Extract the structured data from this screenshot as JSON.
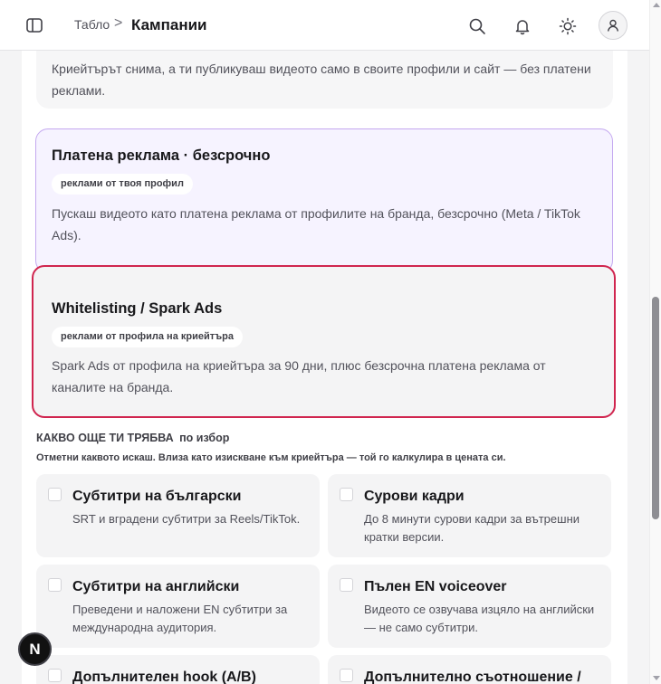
{
  "header": {
    "breadcrumb_parent": "Табло",
    "breadcrumb_separator": ">",
    "breadcrumb_current": "Кампании",
    "icons": [
      "sidebar-toggle-icon",
      "search-icon",
      "bell-icon",
      "sun-icon",
      "user-icon"
    ]
  },
  "options": {
    "organic": {
      "description": "Криейтърът снима, а ти публикуваш видеото само в своите профили и сайт — без платени реклами."
    },
    "paid": {
      "title": "Платена реклама · безсрочно",
      "pill": "реклами от твоя профил",
      "description": "Пускаш видеото като платена реклама от профилите на бранда, безсрочно (Meta / TikTok Ads)."
    },
    "spark": {
      "title": "Whitelisting / Spark Ads",
      "pill": "реклами от профила на криейтъра",
      "description": "Spark Ads от профила на криейтъра за 90 дни, плюс безсрочна платена реклама от каналите на бранда."
    }
  },
  "extras": {
    "heading": "КАКВО ОЩЕ ТИ ТРЯБВА",
    "heading_tag": "по избор",
    "hint": "Отметни каквото искаш. Влиза като изискване към криейтъра — той го калкулира в цената си.",
    "items": [
      {
        "title": "Субтитри на български",
        "description": "SRT и вградени субтитри за Reels/TikTok.",
        "checked": false
      },
      {
        "title": "Сурови кадри",
        "description": "До 8 минути сурови кадри за вътрешни кратки версии.",
        "checked": false
      },
      {
        "title": "Субтитри на английски",
        "description": "Преведени и наложени EN субтитри за международна аудитория.",
        "checked": false
      },
      {
        "title": "Пълен EN voiceover",
        "description": "Видеото се озвучава изцяло на английски — не само субтитри.",
        "checked": false
      },
      {
        "title": "Допълнителен hook (A/B)",
        "description": "",
        "checked": false
      },
      {
        "title": "Допълнително съотношение /",
        "description": "",
        "checked": false
      }
    ]
  },
  "colors": {
    "accent_purple_border": "#c4a8f0",
    "accent_purple_bg": "#f6f3ff",
    "selected_border": "#d0254f"
  },
  "badge": {
    "label": "N"
  }
}
